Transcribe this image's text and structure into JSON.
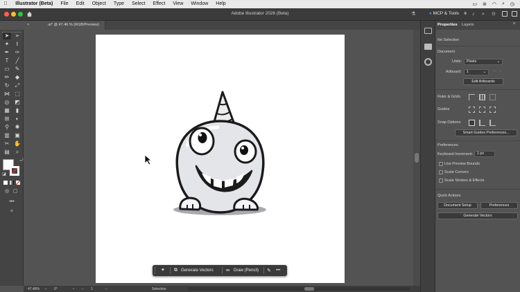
{
  "menubar": {
    "app": "Illustrator (Beta)",
    "items": [
      "File",
      "Edit",
      "Object",
      "Type",
      "Select",
      "Effect",
      "View",
      "Window",
      "Help"
    ],
    "right_icons": [
      "menu-extras-icon",
      "control-center-icon",
      "wifi-icon",
      "search-icon",
      "clock-icon"
    ]
  },
  "appbar": {
    "title": "Adobe Illustrator 2026 (Beta)",
    "mcp_label": "MCP & Tools"
  },
  "doc_tab": {
    "label": ".ai* @ 47.46 % (RGB/Preview)",
    "close": "×"
  },
  "status": {
    "zoom": "47.46%",
    "rotation": "0°",
    "artboard": "1",
    "tool": "Selection"
  },
  "context_bar": {
    "generate": "Generate Vectors",
    "draw": "Draw (Pencil)",
    "more": "•••"
  },
  "panel": {
    "tabs": [
      "Properties",
      "Layers"
    ],
    "no_selection": "No Selection",
    "document": "Document",
    "units_label": "Units:",
    "units_value": "Pixels",
    "artboard_label": "Artboard:",
    "artboard_value": "1",
    "edit_artboards": "Edit Artboards",
    "ruler_grids": "Ruler & Grids",
    "guides": "Guides",
    "snap_options": "Snap Options",
    "smart_guides": "Smart Guides Preferences...",
    "preferences": "Preferences",
    "keyboard_increment_label": "Keyboard Increment:",
    "keyboard_increment_value": "1 px",
    "use_preview_bounds": "Use Preview Bounds",
    "scale_corners": "Scale Corners",
    "scale_strokes": "Scale Strokes & Effects",
    "quick_actions": "Quick Actions",
    "document_setup": "Document Setup",
    "preferences_btn": "Preferences",
    "generate_vectors": "Generate Vectors"
  },
  "colors": {
    "accent": "#4d8ef0",
    "artboard": "#ffffff",
    "workspace": "#535353"
  }
}
